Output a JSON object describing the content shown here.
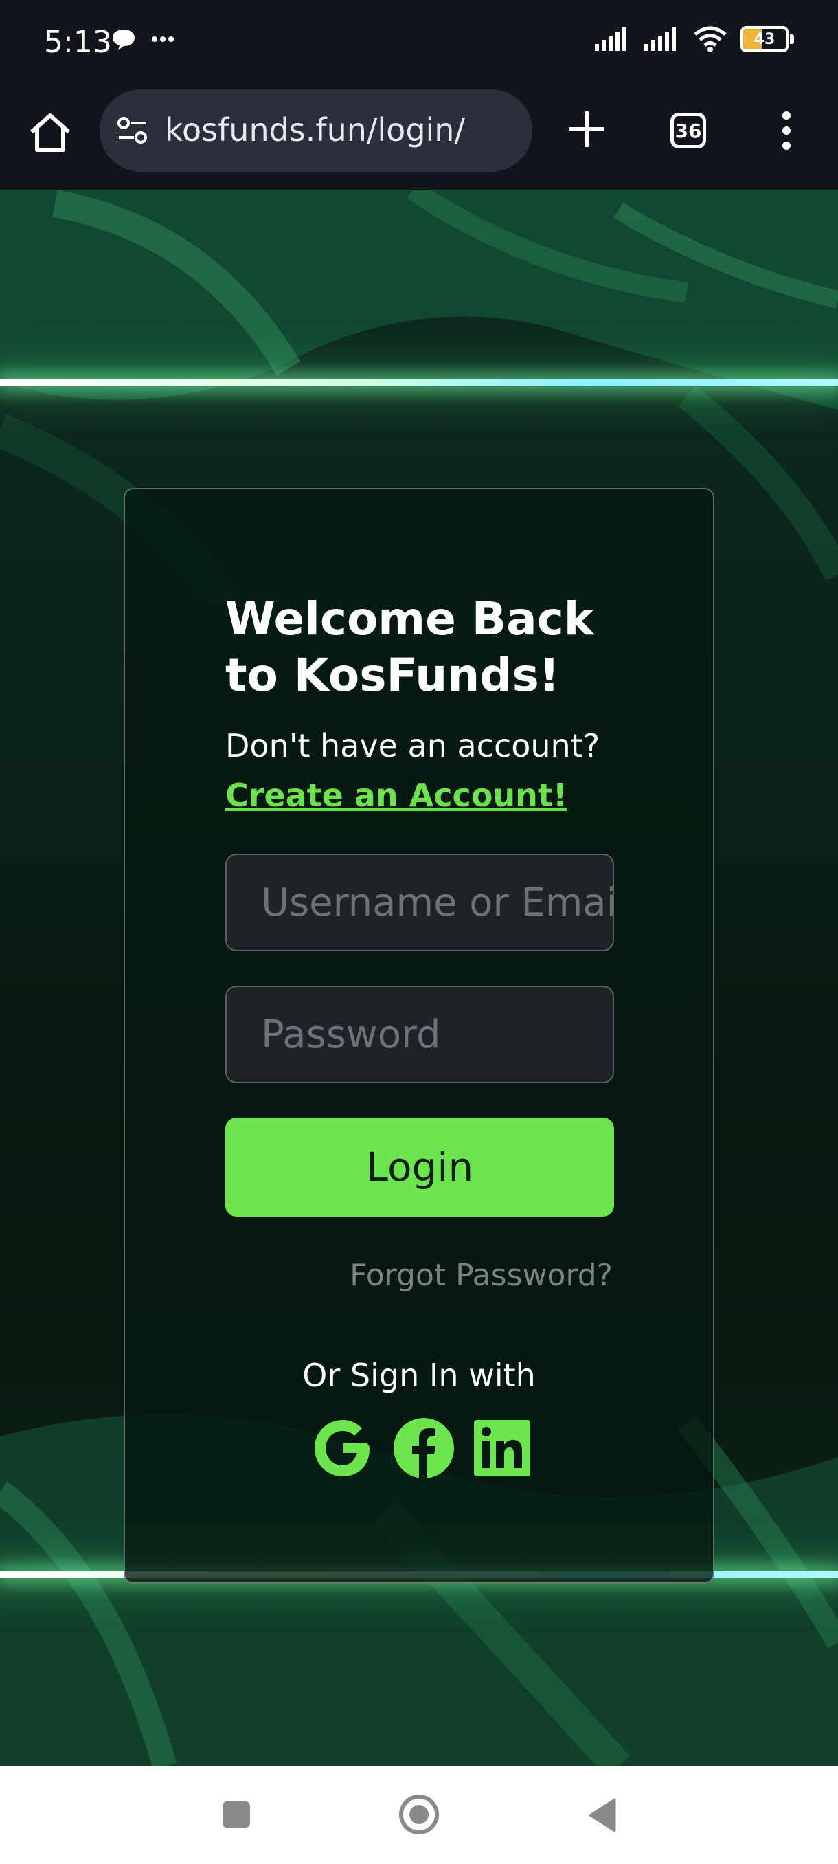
{
  "status_bar": {
    "time": "5:13",
    "battery_level": "43"
  },
  "browser": {
    "url": "kosfunds.fun/login/",
    "tab_count": "36"
  },
  "login": {
    "title": "Welcome Back to KosFunds!",
    "subtitle": "Don't have an account?",
    "create_link": "Create an Account!",
    "username_placeholder": "Username or Email",
    "password_placeholder": "Password",
    "login_button": "Login",
    "forgot_password": "Forgot Password?",
    "or_sign_in": "Or Sign In with",
    "social": [
      "google-icon",
      "facebook-icon",
      "linkedin-icon"
    ]
  },
  "colors": {
    "accent": "#6de54f",
    "card_bg": "#05180f",
    "input_bg": "#1f2227"
  }
}
